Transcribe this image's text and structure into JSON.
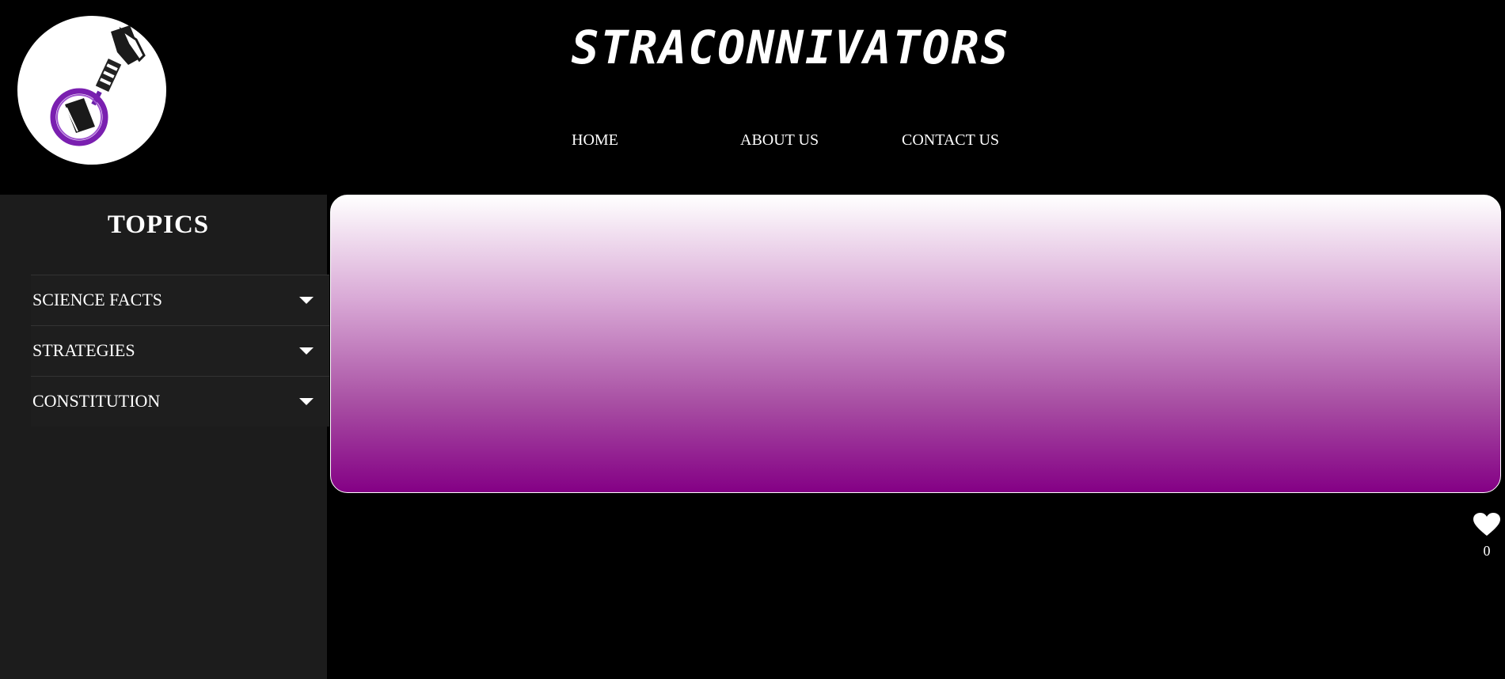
{
  "header": {
    "title": "STRACONNIVATORS",
    "logo_icon": "magnifying-glass-book-logo",
    "nav": [
      {
        "label": "HOME"
      },
      {
        "label": "ABOUT US"
      },
      {
        "label": "CONTACT US"
      }
    ]
  },
  "sidebar": {
    "heading": "TOPICS",
    "items": [
      {
        "label": "SCIENCE FACTS",
        "icon": "caret-down-icon"
      },
      {
        "label": "STRATEGIES",
        "icon": "caret-down-icon"
      },
      {
        "label": "CONSTITUTION",
        "icon": "caret-down-icon"
      }
    ]
  },
  "banner": {
    "gradient_top": "#ffffff",
    "gradient_bottom": "#840085"
  },
  "like": {
    "icon": "heart-icon",
    "count": "0"
  },
  "colors": {
    "background": "#000000",
    "sidebar": "#1c1c1c",
    "text": "#ffffff",
    "accent": "#840085"
  }
}
